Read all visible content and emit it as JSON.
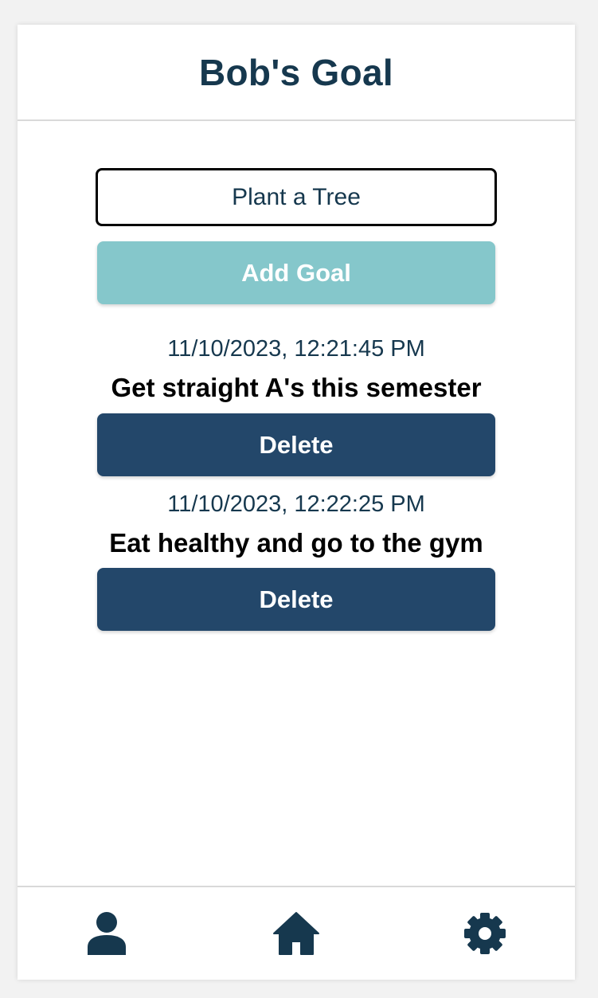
{
  "header": {
    "title": "Bob's Goal"
  },
  "form": {
    "input_value": "Plant a Tree",
    "add_label": "Add Goal"
  },
  "goals": [
    {
      "timestamp": "11/10/2023, 12:21:45 PM",
      "text": "Get straight A's this semester",
      "delete_label": "Delete"
    },
    {
      "timestamp": "11/10/2023, 12:22:25 PM",
      "text": "Eat healthy and go to the gym",
      "delete_label": "Delete"
    }
  ],
  "nav": {
    "items": [
      {
        "icon": "person-icon"
      },
      {
        "icon": "home-icon"
      },
      {
        "icon": "gear-icon"
      }
    ]
  },
  "colors": {
    "primary_dark": "#16384e",
    "delete_button": "#23476a",
    "add_button": "#85c7cb"
  }
}
